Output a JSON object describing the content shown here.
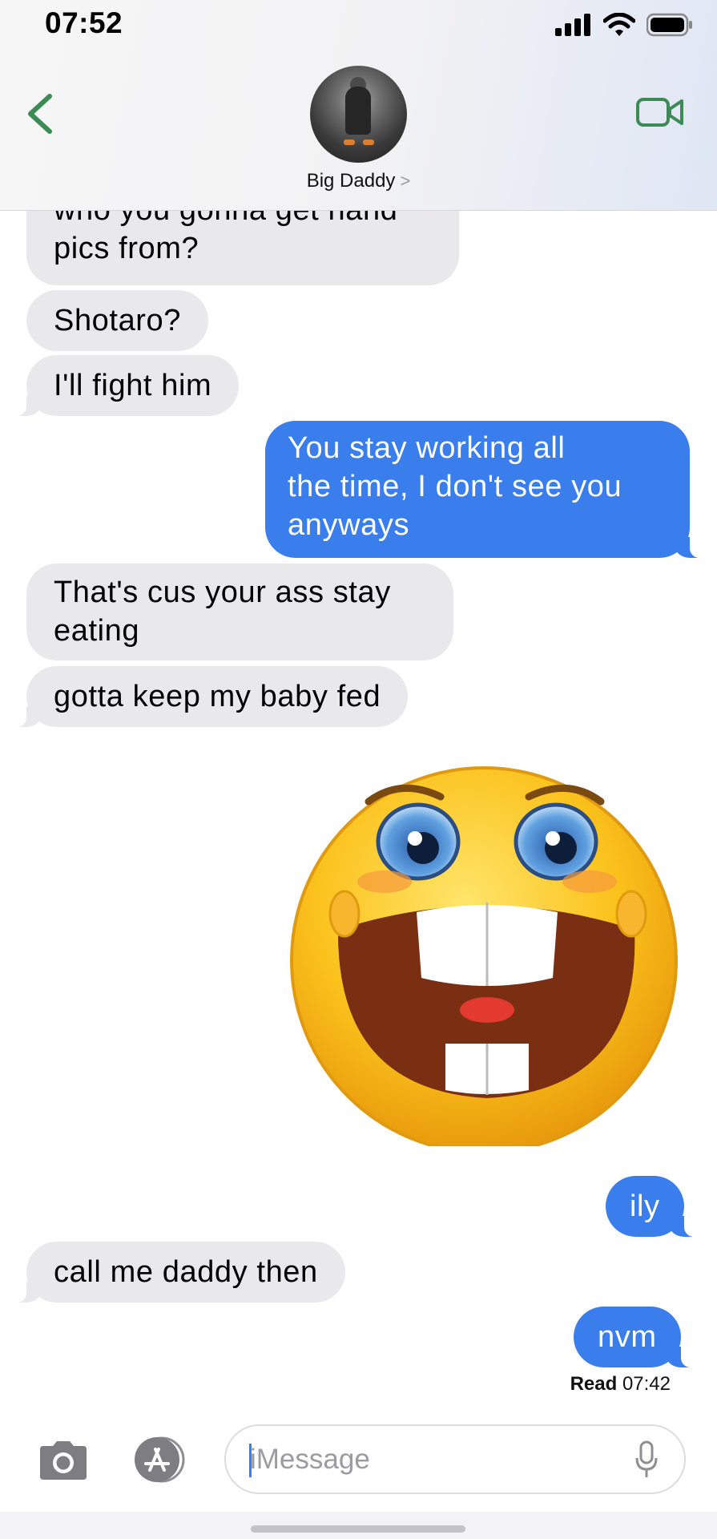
{
  "status_bar": {
    "time": "07:52",
    "icons": [
      "signal-icon",
      "wifi-icon",
      "battery-icon"
    ]
  },
  "header": {
    "back_icon": "chevron-left-icon",
    "contact_name": "Big Daddy",
    "name_chevron": ">",
    "video_icon": "video-camera-icon",
    "accent_color": "#3c8a55"
  },
  "messages": [
    {
      "side": "received",
      "lines": [
        "who you gonna get hand",
        "pics from?"
      ]
    },
    {
      "side": "received",
      "lines": [
        "Shotaro?"
      ]
    },
    {
      "side": "received",
      "lines": [
        "I'll fight him"
      ]
    },
    {
      "side": "sent",
      "lines": [
        "You stay working all",
        "the time, I don't see you",
        "anyways"
      ]
    },
    {
      "side": "received",
      "lines": [
        "That's cus your ass stay",
        "eating"
      ]
    },
    {
      "side": "received",
      "lines": [
        "gotta keep my baby fed"
      ]
    },
    {
      "side": "sent",
      "type": "image",
      "image": "laughing-emoji-sticker-image"
    },
    {
      "side": "sent",
      "lines": [
        "ily"
      ]
    },
    {
      "side": "received",
      "lines": [
        "call me daddy then"
      ]
    },
    {
      "side": "sent",
      "lines": [
        "nvm"
      ]
    }
  ],
  "read_receipt": {
    "label": "Read",
    "time": "07:42"
  },
  "composer": {
    "placeholder": "iMessage",
    "camera_icon": "camera-icon",
    "apps_icon": "app-store-icon",
    "mic_icon": "microphone-icon"
  },
  "colors": {
    "sent_bubble": "#3a7ded",
    "received_bubble": "#e9e9eb"
  }
}
